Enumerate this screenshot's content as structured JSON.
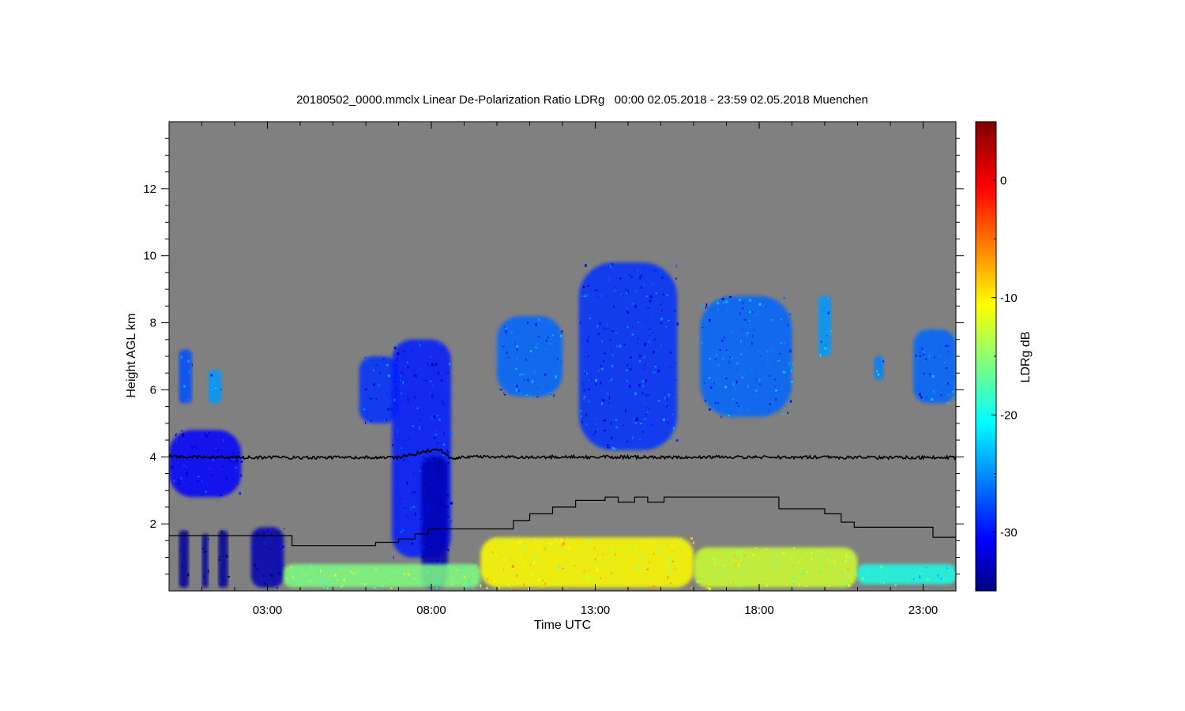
{
  "chart_data": {
    "type": "heatmap",
    "title": "20180502_0000.mmclx Linear De-Polarization Ratio LDRg   00:00 02.05.2018 - 23:59 02.05.2018 Muenchen",
    "xlabel": "Time UTC",
    "ylabel": "Height AGL km",
    "colorbar_label": "LDRg dB",
    "x_unit": "hours UTC",
    "xlim": [
      0,
      24
    ],
    "ylim": [
      0,
      14
    ],
    "x_ticks": [
      {
        "value": 3,
        "label": "03:00"
      },
      {
        "value": 8,
        "label": "08:00"
      },
      {
        "value": 13,
        "label": "13:00"
      },
      {
        "value": 18,
        "label": "18:00"
      },
      {
        "value": 23,
        "label": "23:00"
      }
    ],
    "y_ticks": [
      {
        "value": 2,
        "label": "2"
      },
      {
        "value": 4,
        "label": "4"
      },
      {
        "value": 6,
        "label": "6"
      },
      {
        "value": 8,
        "label": "8"
      },
      {
        "value": 10,
        "label": "10"
      },
      {
        "value": 12,
        "label": "12"
      }
    ],
    "colorbar": {
      "range": [
        -35,
        5
      ],
      "ticks": [
        {
          "value": 0,
          "label": "0"
        },
        {
          "value": -10,
          "label": "-10"
        },
        {
          "value": -20,
          "label": "-20"
        },
        {
          "value": -30,
          "label": "-30"
        }
      ],
      "colormap": "jet"
    },
    "background_color": "#808080",
    "regions": [
      {
        "x": [
          0.0,
          2.2
        ],
        "y": [
          2.8,
          4.8
        ],
        "ldr": -30
      },
      {
        "x": [
          0.3,
          0.6
        ],
        "y": [
          0.1,
          1.8
        ],
        "ldr": -34
      },
      {
        "x": [
          1.0,
          1.2
        ],
        "y": [
          0.1,
          1.7
        ],
        "ldr": -34
      },
      {
        "x": [
          1.5,
          1.8
        ],
        "y": [
          0.1,
          1.8
        ],
        "ldr": -34
      },
      {
        "x": [
          2.5,
          3.5
        ],
        "y": [
          0.1,
          1.9
        ],
        "ldr": -33
      },
      {
        "x": [
          0.3,
          0.7
        ],
        "y": [
          5.6,
          7.2
        ],
        "ldr": -27
      },
      {
        "x": [
          1.2,
          1.6
        ],
        "y": [
          5.6,
          6.6
        ],
        "ldr": -24
      },
      {
        "x": [
          5.8,
          7.0
        ],
        "y": [
          5.0,
          7.0
        ],
        "ldr": -28
      },
      {
        "x": [
          6.8,
          8.6
        ],
        "y": [
          1.0,
          7.5
        ],
        "ldr": -29
      },
      {
        "x": [
          7.7,
          8.5
        ],
        "y": [
          0.1,
          4.0
        ],
        "ldr": -33
      },
      {
        "x": [
          10.0,
          12.0
        ],
        "y": [
          5.8,
          8.2
        ],
        "ldr": -26
      },
      {
        "x": [
          12.5,
          15.5
        ],
        "y": [
          4.2,
          9.8
        ],
        "ldr": -28
      },
      {
        "x": [
          16.2,
          19.0
        ],
        "y": [
          5.2,
          8.8
        ],
        "ldr": -26
      },
      {
        "x": [
          19.8,
          20.2
        ],
        "y": [
          7.0,
          8.8
        ],
        "ldr": -24
      },
      {
        "x": [
          21.5,
          21.8
        ],
        "y": [
          6.3,
          7.0
        ],
        "ldr": -25
      },
      {
        "x": [
          22.7,
          24.0
        ],
        "y": [
          5.6,
          7.8
        ],
        "ldr": -26
      },
      {
        "x": [
          3.5,
          9.5
        ],
        "y": [
          0.1,
          0.8
        ],
        "ldr": -15
      },
      {
        "x": [
          9.5,
          16.0
        ],
        "y": [
          0.1,
          1.6
        ],
        "ldr": -10
      },
      {
        "x": [
          16.0,
          21.0
        ],
        "y": [
          0.1,
          1.3
        ],
        "ldr": -12
      },
      {
        "x": [
          21.0,
          24.0
        ],
        "y": [
          0.2,
          0.8
        ],
        "ldr": -19
      }
    ],
    "series": [
      {
        "style": "noisy-line",
        "x": [
          0,
          1.5,
          2,
          7,
          8.2,
          8.6,
          9.0,
          24
        ],
        "y": [
          4.0,
          4.0,
          3.98,
          3.98,
          4.25,
          3.95,
          4.0,
          3.98
        ]
      },
      {
        "style": "step",
        "x": [
          0,
          3.75,
          3.75,
          6.3,
          6.3,
          7.0,
          7.0,
          7.5,
          7.5,
          7.9,
          7.9,
          8.3,
          8.3,
          10.5,
          10.5,
          11.0,
          11.0,
          11.7,
          11.7,
          12.4,
          12.4,
          13.3,
          13.3,
          13.7,
          13.7,
          14.2,
          14.2,
          14.6,
          14.6,
          15.1,
          15.1,
          15.6,
          15.6,
          18.6,
          18.6,
          20.0,
          20.0,
          20.5,
          20.5,
          20.9,
          20.9,
          23.3,
          23.3,
          24
        ],
        "y": [
          1.65,
          1.65,
          1.35,
          1.35,
          1.45,
          1.45,
          1.55,
          1.55,
          1.7,
          1.7,
          1.85,
          1.85,
          1.85,
          1.85,
          2.1,
          2.1,
          2.3,
          2.3,
          2.5,
          2.5,
          2.7,
          2.7,
          2.8,
          2.8,
          2.65,
          2.65,
          2.8,
          2.8,
          2.65,
          2.65,
          2.8,
          2.8,
          2.8,
          2.8,
          2.45,
          2.45,
          2.3,
          2.3,
          2.05,
          2.05,
          1.9,
          1.9,
          1.6,
          1.6
        ]
      }
    ]
  }
}
